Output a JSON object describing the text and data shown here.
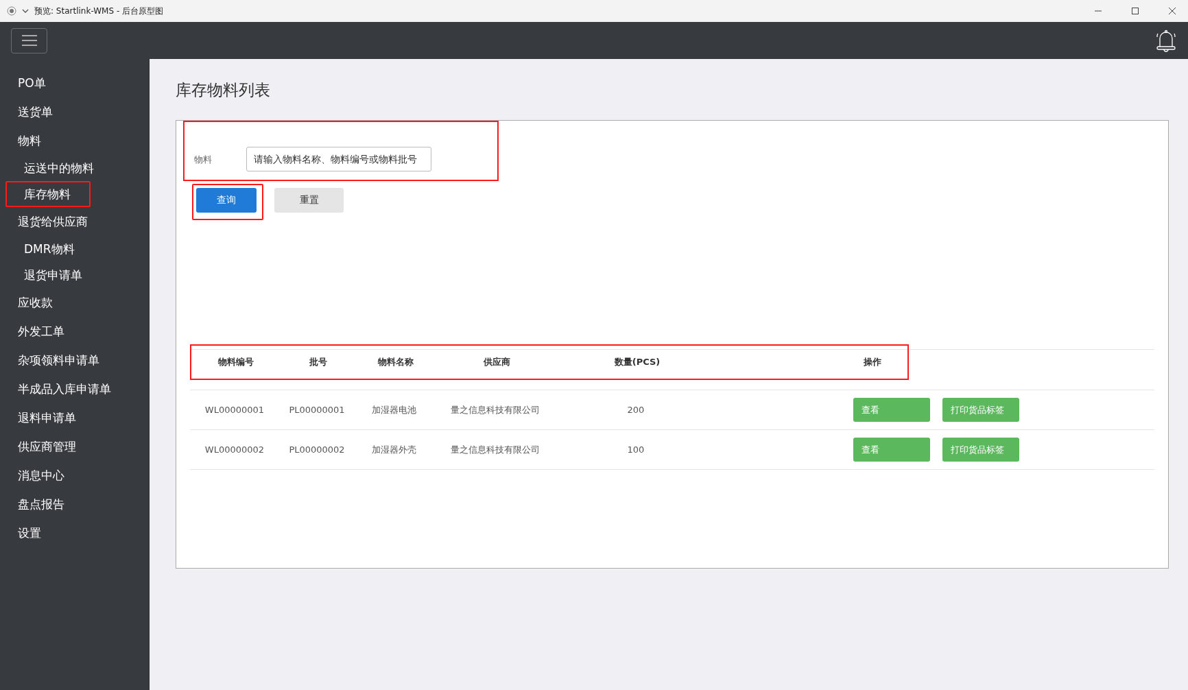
{
  "window": {
    "title": "预览: Startlink-WMS - 后台原型图"
  },
  "sidebar": {
    "items": [
      {
        "label": "PO单",
        "selected": false
      },
      {
        "label": "送货单",
        "selected": false
      },
      {
        "label": "物料",
        "selected": false,
        "children": [
          {
            "label": "运送中的物料",
            "selected": false
          },
          {
            "label": "库存物料",
            "selected": true
          }
        ]
      },
      {
        "label": "退货给供应商",
        "selected": false,
        "children": [
          {
            "label": "DMR物料",
            "selected": false
          },
          {
            "label": "退货申请单",
            "selected": false
          }
        ]
      },
      {
        "label": "应收款",
        "selected": false
      },
      {
        "label": "外发工单",
        "selected": false
      },
      {
        "label": "杂项领料申请单",
        "selected": false
      },
      {
        "label": "半成品入库申请单",
        "selected": false
      },
      {
        "label": "退料申请单",
        "selected": false
      },
      {
        "label": "供应商管理",
        "selected": false
      },
      {
        "label": "消息中心",
        "selected": false
      },
      {
        "label": "盘点报告",
        "selected": false
      },
      {
        "label": "设置",
        "selected": false
      }
    ]
  },
  "page": {
    "title": "库存物料列表"
  },
  "filter": {
    "label": "物料",
    "placeholder": "请输入物料名称、物料编号或物料批号",
    "highlighted": true
  },
  "buttons": [
    {
      "label": "查询",
      "kind": "primary",
      "highlighted": true
    },
    {
      "label": "重置",
      "kind": "secondary",
      "highlighted": false
    }
  ],
  "table": {
    "header_highlighted": true,
    "columns": [
      "物料编号",
      "批号",
      "物料名称",
      "供应商",
      "数量(PCS)",
      "操作"
    ],
    "rows": [
      {
        "cells": [
          "WL00000001",
          "PL00000001",
          "加湿器电池",
          "量之信息科技有限公司",
          "200"
        ],
        "actions": [
          "查看",
          "打印货品标签"
        ]
      },
      {
        "cells": [
          "WL00000002",
          "PL00000002",
          "加湿器外壳",
          "量之信息科技有限公司",
          "100"
        ],
        "actions": [
          "查看",
          "打印货品标签"
        ]
      }
    ]
  }
}
